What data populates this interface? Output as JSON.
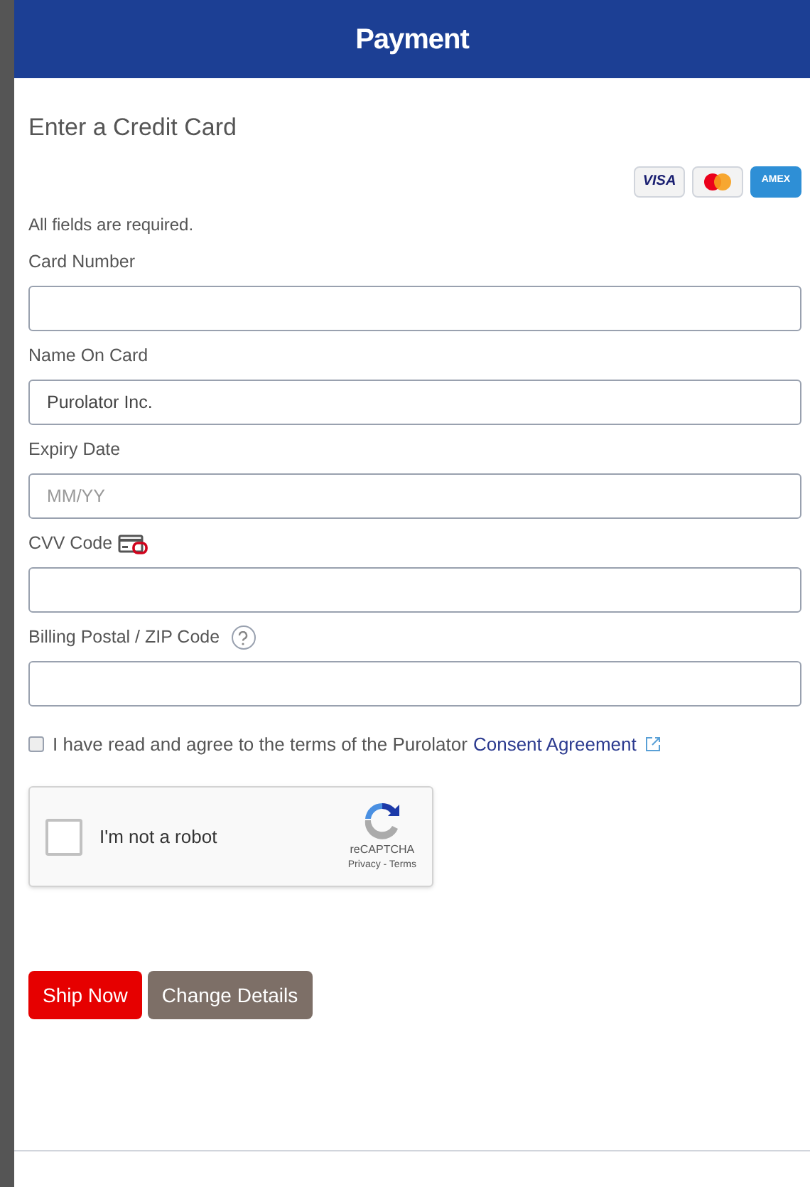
{
  "header": {
    "title": "Payment"
  },
  "section_title": "Enter a Credit Card",
  "card_logos": [
    {
      "kind": "visa",
      "label": "VISA"
    },
    {
      "kind": "mastercard"
    },
    {
      "kind": "amex",
      "label": "AMEX"
    }
  ],
  "note": "All fields are required.",
  "fields": [
    {
      "kind": "plain",
      "label": "Card Number"
    },
    {
      "kind": "plain",
      "label": "Name On Card",
      "value": "Purolator Inc."
    },
    {
      "kind": "plain",
      "label": "Expiry Date",
      "placeholder": "MM/YY"
    },
    {
      "kind": "cvv",
      "label": "CVV Code"
    },
    {
      "kind": "help",
      "label": "Billing Postal / ZIP Code"
    }
  ],
  "consent": {
    "checked": false,
    "text": "I have read and agree to the terms of the Purolator",
    "link": "Consent Agreement"
  },
  "captcha": {
    "checked": false,
    "label": "I'm not a robot",
    "brand": "reCAPTCHA",
    "links": "Privacy - Terms"
  },
  "buttons": [
    {
      "kind": "primary",
      "label": "Ship Now"
    },
    {
      "kind": "secondary",
      "label": "Change Details"
    }
  ]
}
